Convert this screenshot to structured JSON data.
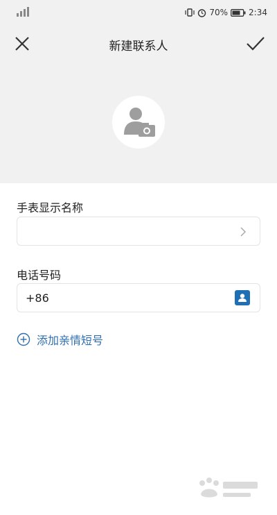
{
  "status_bar": {
    "battery_percent": "70%",
    "time": "2:34",
    "icons": [
      "signal-icon",
      "vibrate-icon",
      "alarm-icon",
      "battery-icon"
    ]
  },
  "header": {
    "title": "新建联系人",
    "icons": [
      "close-icon",
      "check-icon",
      "avatar-camera-icon"
    ]
  },
  "form": {
    "watch_name_label": "手表显示名称",
    "phone_label": "电话号码",
    "phone_value": "+86",
    "add_short_number": "添加亲情短号"
  },
  "colors": {
    "accent": "#2f6fb0",
    "contact_icon": "#1e6fb4",
    "header_bg": "#f1f1f1"
  },
  "watermark": {
    "logo": "baidu-jingyan-logo"
  }
}
